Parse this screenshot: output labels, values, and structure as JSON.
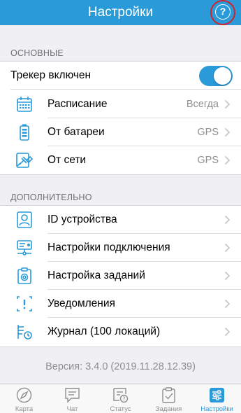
{
  "header": {
    "title": "Настройки",
    "help_glyph": "?"
  },
  "sections": {
    "main": {
      "title": "ОСНОВНЫЕ",
      "tracker": {
        "label": "Трекер включен",
        "enabled": true
      },
      "rows": [
        {
          "icon": "calendar-icon",
          "label": "Расписание",
          "value": "Всегда"
        },
        {
          "icon": "battery-icon",
          "label": "От батареи",
          "value": "GPS"
        },
        {
          "icon": "power-plug-icon",
          "label": "От сети",
          "value": "GPS"
        }
      ]
    },
    "extra": {
      "title": "ДОПОЛНИТЕЛЬНО",
      "rows": [
        {
          "icon": "device-id-icon",
          "label": "ID устройства"
        },
        {
          "icon": "connection-settings-icon",
          "label": "Настройки подключения"
        },
        {
          "icon": "task-settings-icon",
          "label": "Настройка заданий"
        },
        {
          "icon": "notification-icon",
          "label": "Уведомления"
        },
        {
          "icon": "journal-icon",
          "label": "Журнал (100 локаций)"
        }
      ]
    }
  },
  "version": "Версия: 3.4.0 (2019.11.28.12.39)",
  "tabbar": {
    "tabs": [
      {
        "icon": "compass-icon",
        "label": "Карта"
      },
      {
        "icon": "chat-icon",
        "label": "Чат"
      },
      {
        "icon": "status-icon",
        "label": "Статус"
      },
      {
        "icon": "tasks-icon",
        "label": "Задания"
      },
      {
        "icon": "settings-sliders-icon",
        "label": "Настройки"
      }
    ],
    "active_index": 4
  },
  "colors": {
    "accent": "#2a9ad8",
    "highlight_ring": "#d6202a",
    "background": "#efeff4"
  }
}
